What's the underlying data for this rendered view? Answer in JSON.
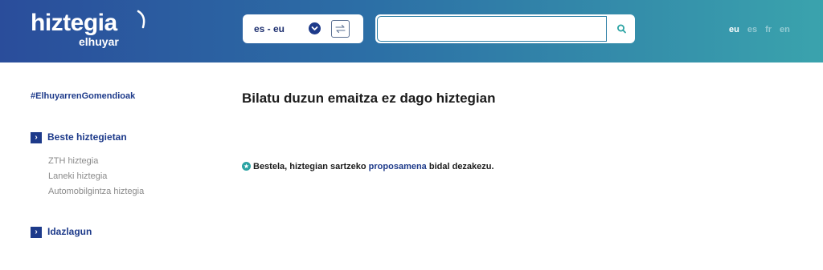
{
  "header": {
    "logo_main": "hiztegia",
    "logo_sub": "elhuyar",
    "language_pair": "es - eu",
    "search": {
      "value": "",
      "placeholder": ""
    },
    "languages": [
      {
        "code": "eu",
        "active": true
      },
      {
        "code": "es",
        "active": false
      },
      {
        "code": "fr",
        "active": false
      },
      {
        "code": "en",
        "active": false
      }
    ]
  },
  "sidebar": {
    "hashtag": "#ElhuyarrenGomendioak",
    "sections": [
      {
        "label": "Beste hiztegietan",
        "links": [
          "ZTH hiztegia",
          "Laneki hiztegia",
          "Automobilgintza hiztegia"
        ]
      },
      {
        "label": "Idazlagun",
        "links": []
      }
    ]
  },
  "main": {
    "title": "Bilatu duzun emaitza ez dago hiztegian",
    "hint_before": "Bestela, hiztegian sartzeko ",
    "hint_link": "proposamena",
    "hint_after": " bidal dezakezu."
  },
  "colors": {
    "brand_blue": "#1d3a8a",
    "teal": "#2aa3a3",
    "header_left": "#2a4d9b",
    "header_right": "#3aa3ad"
  },
  "icons": [
    "chevron-down-icon",
    "swap-arrows-icon",
    "search-icon",
    "chevron-right-icon",
    "star-badge-icon"
  ]
}
